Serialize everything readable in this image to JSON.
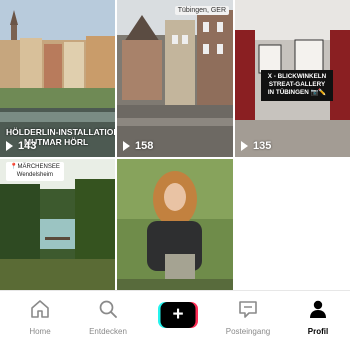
{
  "tiles": [
    {
      "caption_line1": "HÖLDERLIN-INSTALLATION",
      "caption_line2": "MUTMAR HÖRL",
      "views": "143"
    },
    {
      "location_tag": "Tübingen, GER",
      "views": "158"
    },
    {
      "box_text": "X - BLICKWINKELN STREAT-GALLERY IN TÜBINGEN 📷✏️",
      "views": "135"
    },
    {
      "sticker_line1": "MÄRCHENSEE",
      "sticker_line2": "Wendelsheim"
    },
    {}
  ],
  "nav": {
    "home": "Home",
    "discover": "Entdecken",
    "create": "+",
    "inbox": "Posteingang",
    "profile": "Profil"
  },
  "colors": {
    "accent_cyan": "#25f4ee",
    "accent_red": "#fe2c55",
    "active_tab": "#000000",
    "inactive_tab": "#8a8a8a"
  }
}
